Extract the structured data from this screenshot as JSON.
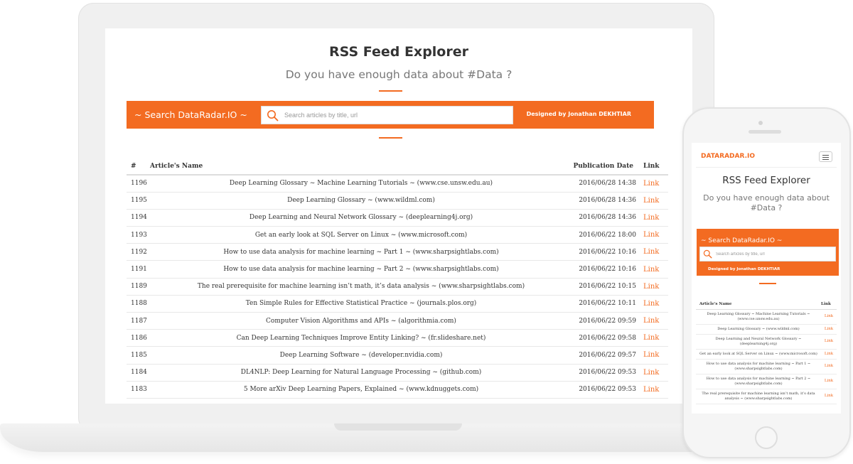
{
  "desktop": {
    "title": "RSS Feed Explorer",
    "subtitle": "Do you have enough data about #Data ?",
    "brand": "~ Search DataRadar.IO ~",
    "search_placeholder": "Search articles by title, url",
    "designer": "Designed by Jonathan DEKHTIAR",
    "columns": {
      "num": "#",
      "name": "Article's Name",
      "date": "Publication Date",
      "link": "Link"
    },
    "rows": [
      {
        "num": "1196",
        "name": "Deep Learning Glossary ~ Machine Learning Tutorials ~ (www.cse.unsw.edu.au)",
        "date": "2016/06/28 14:38",
        "link": "Link"
      },
      {
        "num": "1195",
        "name": "Deep Learning Glossary ~ (www.wildml.com)",
        "date": "2016/06/28 14:36",
        "link": "Link"
      },
      {
        "num": "1194",
        "name": "Deep Learning and Neural Network Glossary ~ (deeplearning4j.org)",
        "date": "2016/06/28 14:36",
        "link": "Link"
      },
      {
        "num": "1193",
        "name": "Get an early look at SQL Server on Linux ~ (www.microsoft.com)",
        "date": "2016/06/22 18:00",
        "link": "Link"
      },
      {
        "num": "1192",
        "name": "How to use data analysis for machine learning ~ Part 1 ~ (www.sharpsightlabs.com)",
        "date": "2016/06/22 10:16",
        "link": "Link"
      },
      {
        "num": "1191",
        "name": "How to use data analysis for machine learning ~ Part 2 ~ (www.sharpsightlabs.com)",
        "date": "2016/06/22 10:16",
        "link": "Link"
      },
      {
        "num": "1189",
        "name": "The real prerequisite for machine learning isn’t math, it’s data analysis ~ (www.sharpsightlabs.com)",
        "date": "2016/06/22 10:15",
        "link": "Link"
      },
      {
        "num": "1188",
        "name": "Ten Simple Rules for Effective Statistical Practice ~ (journals.plos.org)",
        "date": "2016/06/22 10:11",
        "link": "Link"
      },
      {
        "num": "1187",
        "name": "Computer Vision Algorithms and APIs ~ (algorithmia.com)",
        "date": "2016/06/22 09:59",
        "link": "Link"
      },
      {
        "num": "1186",
        "name": "Can Deep Learning Techniques Improve Entity Linking? ~ (fr.slideshare.net)",
        "date": "2016/06/22 09:58",
        "link": "Link"
      },
      {
        "num": "1185",
        "name": "Deep Learning Software ~ (developer.nvidia.com)",
        "date": "2016/06/22 09:57",
        "link": "Link"
      },
      {
        "num": "1184",
        "name": "DL4NLP: Deep Learning for Natural Language Processing ~ (github.com)",
        "date": "2016/06/22 09:53",
        "link": "Link"
      },
      {
        "num": "1183",
        "name": "5 More arXiv Deep Learning Papers, Explained ~ (www.kdnuggets.com)",
        "date": "2016/06/22 09:53",
        "link": "Link"
      }
    ]
  },
  "mobile": {
    "brand": "DATARADAR.IO",
    "title": "RSS Feed Explorer",
    "subtitle": "Do you have enough data about #Data ?",
    "search_brand": "~ Search DataRadar.IO ~",
    "search_placeholder": "Search articles by title, url",
    "designer": "Designed by Jonathan DEKHTIAR",
    "columns": {
      "name": "Article's Name",
      "link": "Link"
    },
    "rows": [
      {
        "name": "Deep Learning Glossary ~ Machine Learning Tutorials ~ (www.cse.unsw.edu.au)",
        "link": "Link"
      },
      {
        "name": "Deep Learning Glossary ~ (www.wildml.com)",
        "link": "Link"
      },
      {
        "name": "Deep Learning and Neural Network Glossary ~ (deeplearning4j.org)",
        "link": "Link"
      },
      {
        "name": "Get an early look at SQL Server on Linux ~ (www.microsoft.com)",
        "link": "Link"
      },
      {
        "name": "How to use data analysis for machine learning ~ Part 1 ~ (www.sharpsightlabs.com)",
        "link": "Link"
      },
      {
        "name": "How to use data analysis for machine learning ~ Part 2 ~ (www.sharpsightlabs.com)",
        "link": "Link"
      },
      {
        "name": "The real prerequisite for machine learning isn’t math, it’s data analysis ~ (www.sharpsightlabs.com)",
        "link": "Link"
      }
    ]
  },
  "colors": {
    "accent": "#f36b21",
    "text": "#333333",
    "muted": "#777777"
  },
  "icons": {
    "search": "search-icon",
    "menu": "hamburger-icon"
  }
}
